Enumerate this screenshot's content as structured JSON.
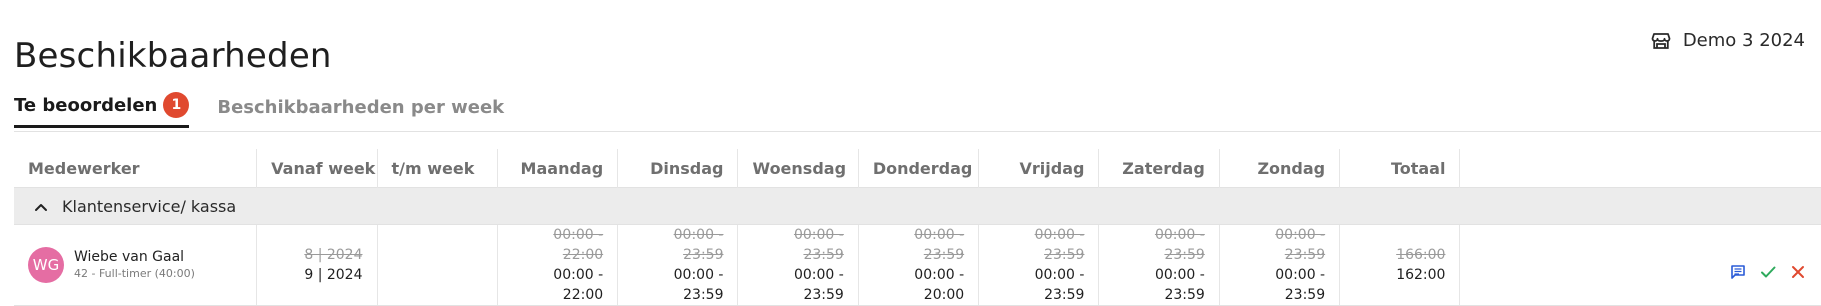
{
  "page": {
    "title": "Beschikbaarheden"
  },
  "store": {
    "icon": "store-icon",
    "name": "Demo 3 2024"
  },
  "tabs": [
    {
      "label": "Te beoordelen",
      "badge": "1",
      "active": true
    },
    {
      "label": "Beschikbaarheden per week",
      "active": false
    }
  ],
  "table": {
    "headers": {
      "employee": "Medewerker",
      "from_week": "Vanaf week",
      "to_week": "t/m week",
      "monday": "Maandag",
      "tuesday": "Dinsdag",
      "wednesday": "Woensdag",
      "thursday": "Donderdag",
      "friday": "Vrijdag",
      "saturday": "Zaterdag",
      "sunday": "Zondag",
      "total": "Totaal"
    },
    "group": {
      "label": "Klantenservice/ kassa",
      "icon": "chevron-up-icon"
    },
    "row": {
      "initials": "WG",
      "name": "Wiebe van Gaal",
      "contract": "42 - Full-timer (40:00)",
      "from_week_old": "8 | 2024",
      "from_week_new": "9 | 2024",
      "monday_old": "00:00 - 22:00",
      "monday_new": "00:00 - 22:00",
      "tuesday_old": "00:00 - 23:59",
      "tuesday_new": "00:00 - 23:59",
      "wednesday_old": "00:00 - 23:59",
      "wednesday_new": "00:00 - 23:59",
      "thursday_old": "00:00 - 23:59",
      "thursday_new": "00:00 - 20:00",
      "friday_old": "00:00 - 23:59",
      "friday_new": "00:00 - 23:59",
      "saturday_old": "00:00 - 23:59",
      "saturday_new": "00:00 - 23:59",
      "sunday_old": "00:00 - 23:59",
      "sunday_new": "00:00 - 23:59",
      "total_old": "166:00",
      "total_new": "162:00"
    },
    "actions": [
      "comment-icon",
      "approve-check-icon",
      "reject-close-icon"
    ]
  },
  "colors": {
    "badge": "#e0492f",
    "avatar": "#e56da3",
    "comment": "#2a5bd7",
    "approve": "#2eaa5c",
    "reject": "#e0492f"
  }
}
